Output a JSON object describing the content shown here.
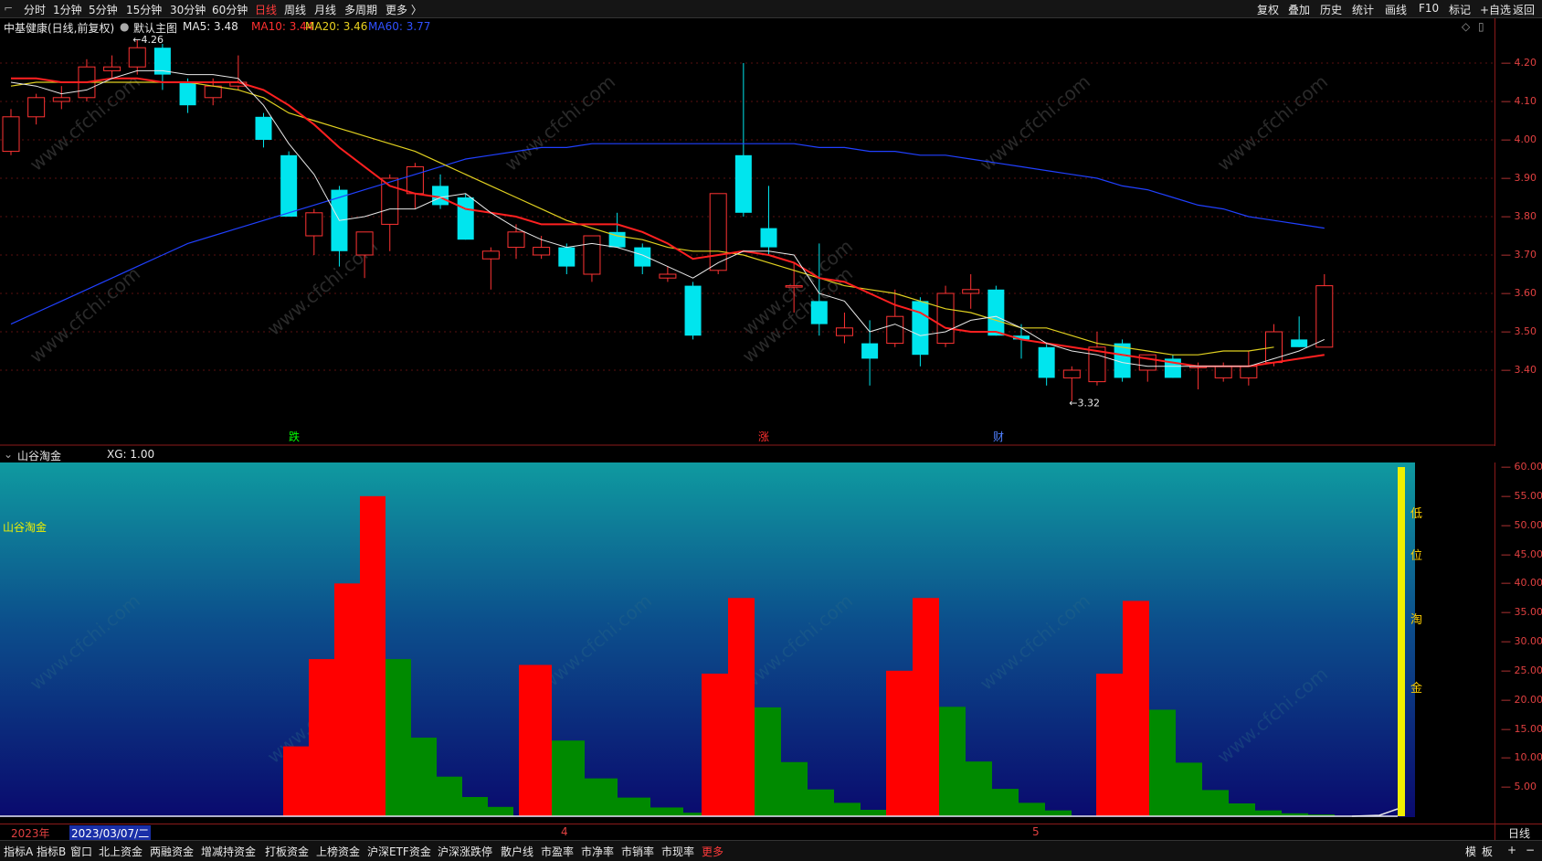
{
  "topbar": {
    "tabs": [
      "分时",
      "1分钟",
      "5分钟",
      "15分钟",
      "30分钟",
      "60分钟",
      "日线",
      "周线",
      "月线",
      "多周期",
      "更多 〉"
    ],
    "active_tab": "日线",
    "right_buttons": [
      "复权",
      "叠加",
      "历史",
      "统计",
      "画线",
      "F10",
      "标记",
      "+自选",
      "返回"
    ]
  },
  "info": {
    "stock": "中基健康(日线,前复权)",
    "theme": "默认主图",
    "ma5": "MA5: 3.48",
    "ma10": "MA10: 3.44",
    "ma20": "MA20: 3.46",
    "ma60": "MA60: 3.77",
    "high_label": "4.26",
    "low_label": "3.32",
    "events": [
      "跌",
      "涨",
      "财"
    ]
  },
  "colors": {
    "up": "#ff3333",
    "down": "#00e5ee",
    "ma5": "#e8e8e8",
    "ma10": "#ff2020",
    "ma20": "#e0d020",
    "ma60": "#2040ff",
    "bar_red": "#ff0000",
    "bar_green": "#008a00",
    "yellow_bar": "#f0f000"
  },
  "price_axis": [
    "4.20",
    "4.10",
    "4.00",
    "3.90",
    "3.80",
    "3.70",
    "3.60",
    "3.50",
    "3.40"
  ],
  "candles": [
    {
      "o": 3.97,
      "h": 4.08,
      "l": 3.96,
      "c": 4.06
    },
    {
      "o": 4.06,
      "h": 4.12,
      "l": 4.04,
      "c": 4.11
    },
    {
      "o": 4.1,
      "h": 4.14,
      "l": 4.08,
      "c": 4.11
    },
    {
      "o": 4.11,
      "h": 4.21,
      "l": 4.1,
      "c": 4.19
    },
    {
      "o": 4.18,
      "h": 4.22,
      "l": 4.16,
      "c": 4.19
    },
    {
      "o": 4.19,
      "h": 4.26,
      "l": 4.17,
      "c": 4.24
    },
    {
      "o": 4.24,
      "h": 4.25,
      "l": 4.13,
      "c": 4.17
    },
    {
      "o": 4.15,
      "h": 4.16,
      "l": 4.07,
      "c": 4.09
    },
    {
      "o": 4.11,
      "h": 4.16,
      "l": 4.09,
      "c": 4.14
    },
    {
      "o": 4.14,
      "h": 4.22,
      "l": 4.13,
      "c": 4.15
    },
    {
      "o": 4.06,
      "h": 4.07,
      "l": 3.98,
      "c": 4.0
    },
    {
      "o": 3.96,
      "h": 3.97,
      "l": 3.8,
      "c": 3.8
    },
    {
      "o": 3.75,
      "h": 3.82,
      "l": 3.7,
      "c": 3.81
    },
    {
      "o": 3.87,
      "h": 3.88,
      "l": 3.67,
      "c": 3.71
    },
    {
      "o": 3.7,
      "h": 3.76,
      "l": 3.64,
      "c": 3.76
    },
    {
      "o": 3.78,
      "h": 3.91,
      "l": 3.71,
      "c": 3.9
    },
    {
      "o": 3.86,
      "h": 3.94,
      "l": 3.82,
      "c": 3.93
    },
    {
      "o": 3.88,
      "h": 3.91,
      "l": 3.82,
      "c": 3.83
    },
    {
      "o": 3.85,
      "h": 3.86,
      "l": 3.74,
      "c": 3.74
    },
    {
      "o": 3.69,
      "h": 3.72,
      "l": 3.61,
      "c": 3.71
    },
    {
      "o": 3.72,
      "h": 3.78,
      "l": 3.69,
      "c": 3.76
    },
    {
      "o": 3.7,
      "h": 3.75,
      "l": 3.69,
      "c": 3.72
    },
    {
      "o": 3.72,
      "h": 3.73,
      "l": 3.65,
      "c": 3.67
    },
    {
      "o": 3.65,
      "h": 3.75,
      "l": 3.63,
      "c": 3.75
    },
    {
      "o": 3.76,
      "h": 3.81,
      "l": 3.72,
      "c": 3.72
    },
    {
      "o": 3.72,
      "h": 3.73,
      "l": 3.65,
      "c": 3.67
    },
    {
      "o": 3.64,
      "h": 3.67,
      "l": 3.63,
      "c": 3.65
    },
    {
      "o": 3.62,
      "h": 3.63,
      "l": 3.48,
      "c": 3.49
    },
    {
      "o": 3.66,
      "h": 3.86,
      "l": 3.65,
      "c": 3.86
    },
    {
      "o": 3.96,
      "h": 4.2,
      "l": 3.8,
      "c": 3.81
    },
    {
      "o": 3.77,
      "h": 3.88,
      "l": 3.7,
      "c": 3.72
    },
    {
      "o": 3.62,
      "h": 3.68,
      "l": 3.55,
      "c": 3.62
    },
    {
      "o": 3.58,
      "h": 3.73,
      "l": 3.49,
      "c": 3.52
    },
    {
      "o": 3.49,
      "h": 3.55,
      "l": 3.47,
      "c": 3.51
    },
    {
      "o": 3.47,
      "h": 3.53,
      "l": 3.36,
      "c": 3.43
    },
    {
      "o": 3.47,
      "h": 3.61,
      "l": 3.46,
      "c": 3.54
    },
    {
      "o": 3.58,
      "h": 3.59,
      "l": 3.41,
      "c": 3.44
    },
    {
      "o": 3.47,
      "h": 3.62,
      "l": 3.46,
      "c": 3.6
    },
    {
      "o": 3.6,
      "h": 3.65,
      "l": 3.56,
      "c": 3.61
    },
    {
      "o": 3.61,
      "h": 3.62,
      "l": 3.49,
      "c": 3.49
    },
    {
      "o": 3.49,
      "h": 3.52,
      "l": 3.43,
      "c": 3.48
    },
    {
      "o": 3.46,
      "h": 3.47,
      "l": 3.36,
      "c": 3.38
    },
    {
      "o": 3.38,
      "h": 3.41,
      "l": 3.32,
      "c": 3.4
    },
    {
      "o": 3.37,
      "h": 3.5,
      "l": 3.36,
      "c": 3.46
    },
    {
      "o": 3.47,
      "h": 3.48,
      "l": 3.37,
      "c": 3.38
    },
    {
      "o": 3.4,
      "h": 3.44,
      "l": 3.37,
      "c": 3.44
    },
    {
      "o": 3.43,
      "h": 3.44,
      "l": 3.38,
      "c": 3.38
    },
    {
      "o": 3.41,
      "h": 3.42,
      "l": 3.35,
      "c": 3.41
    },
    {
      "o": 3.38,
      "h": 3.42,
      "l": 3.37,
      "c": 3.41
    },
    {
      "o": 3.38,
      "h": 3.45,
      "l": 3.36,
      "c": 3.41
    },
    {
      "o": 3.42,
      "h": 3.52,
      "l": 3.41,
      "c": 3.5
    },
    {
      "o": 3.48,
      "h": 3.54,
      "l": 3.46,
      "c": 3.46
    },
    {
      "o": 3.46,
      "h": 3.65,
      "l": 3.46,
      "c": 3.62
    }
  ],
  "ma5_values": [
    4.15,
    4.14,
    4.12,
    4.13,
    4.16,
    4.18,
    4.18,
    4.17,
    4.17,
    4.16,
    4.09,
    3.99,
    3.91,
    3.79,
    3.8,
    3.82,
    3.82,
    3.85,
    3.86,
    3.81,
    3.77,
    3.74,
    3.72,
    3.73,
    3.72,
    3.7,
    3.67,
    3.64,
    3.68,
    3.71,
    3.71,
    3.7,
    3.6,
    3.58,
    3.5,
    3.52,
    3.49,
    3.5,
    3.53,
    3.54,
    3.51,
    3.47,
    3.45,
    3.44,
    3.42,
    3.41,
    3.41,
    3.41,
    3.41,
    3.41,
    3.43,
    3.45,
    3.48
  ],
  "ma10_values": [
    4.16,
    4.16,
    4.15,
    4.15,
    4.16,
    4.16,
    4.15,
    4.15,
    4.15,
    4.15,
    4.13,
    4.09,
    4.04,
    3.98,
    3.93,
    3.88,
    3.86,
    3.85,
    3.82,
    3.81,
    3.8,
    3.78,
    3.78,
    3.78,
    3.78,
    3.76,
    3.73,
    3.69,
    3.7,
    3.71,
    3.7,
    3.68,
    3.64,
    3.63,
    3.6,
    3.57,
    3.55,
    3.51,
    3.5,
    3.5,
    3.48,
    3.47,
    3.46,
    3.45,
    3.44,
    3.43,
    3.42,
    3.41,
    3.41,
    3.41,
    3.42,
    3.43,
    3.44
  ],
  "ma20_values": [
    4.14,
    4.15,
    4.15,
    4.15,
    4.15,
    4.15,
    4.15,
    4.15,
    4.14,
    4.13,
    4.11,
    4.07,
    4.05,
    4.03,
    4.01,
    3.99,
    3.97,
    3.94,
    3.91,
    3.88,
    3.85,
    3.82,
    3.79,
    3.77,
    3.75,
    3.74,
    3.72,
    3.71,
    3.71,
    3.7,
    3.68,
    3.66,
    3.64,
    3.62,
    3.61,
    3.6,
    3.58,
    3.56,
    3.55,
    3.53,
    3.51,
    3.51,
    3.49,
    3.47,
    3.46,
    3.45,
    3.44,
    3.44,
    3.45,
    3.45,
    3.46
  ],
  "ma60_values": [
    3.52,
    3.55,
    3.58,
    3.61,
    3.64,
    3.67,
    3.7,
    3.73,
    3.75,
    3.77,
    3.79,
    3.81,
    3.83,
    3.85,
    3.87,
    3.89,
    3.91,
    3.93,
    3.95,
    3.96,
    3.97,
    3.98,
    3.98,
    3.99,
    3.99,
    3.99,
    3.99,
    3.99,
    3.99,
    3.99,
    3.99,
    3.99,
    3.98,
    3.98,
    3.97,
    3.97,
    3.96,
    3.96,
    3.95,
    3.94,
    3.93,
    3.92,
    3.91,
    3.9,
    3.88,
    3.87,
    3.85,
    3.83,
    3.82,
    3.8,
    3.79,
    3.78,
    3.77
  ],
  "sub": {
    "title": "山谷淘金",
    "xg": "XG: 1.00",
    "label": "山谷淘金",
    "side_chars": [
      "低",
      "位",
      "淘",
      "金"
    ],
    "axis": [
      "60.00",
      "55.00",
      "50.00",
      "45.00",
      "40.00",
      "35.00",
      "30.00",
      "25.00",
      "20.00",
      "15.00",
      "10.00",
      "5.00"
    ],
    "bars": [
      {
        "color": "red",
        "v": 12
      },
      {
        "color": "red",
        "v": 27
      },
      {
        "color": "red",
        "v": 40
      },
      {
        "color": "red",
        "v": 55
      },
      {
        "color": "green",
        "v": 27
      },
      {
        "color": "green",
        "v": 13.5
      },
      {
        "color": "green",
        "v": 6.8
      },
      {
        "color": "green",
        "v": 3.3
      },
      {
        "color": "green",
        "v": 1.6
      },
      {
        "color": "red",
        "v": 26
      },
      {
        "color": "green",
        "v": 13
      },
      {
        "color": "green",
        "v": 6.5
      },
      {
        "color": "green",
        "v": 3.2
      },
      {
        "color": "green",
        "v": 1.5
      },
      {
        "color": "green",
        "v": 0.6
      },
      {
        "color": "red",
        "v": 24.5
      },
      {
        "color": "red",
        "v": 37.5
      },
      {
        "color": "green",
        "v": 18.7
      },
      {
        "color": "green",
        "v": 9.3
      },
      {
        "color": "green",
        "v": 4.6
      },
      {
        "color": "green",
        "v": 2.3
      },
      {
        "color": "green",
        "v": 1.1
      },
      {
        "color": "red",
        "v": 25
      },
      {
        "color": "red",
        "v": 37.5
      },
      {
        "color": "green",
        "v": 18.8
      },
      {
        "color": "green",
        "v": 9.4
      },
      {
        "color": "green",
        "v": 4.7
      },
      {
        "color": "green",
        "v": 2.3
      },
      {
        "color": "green",
        "v": 1.0
      },
      {
        "color": "red",
        "v": 24.5
      },
      {
        "color": "red",
        "v": 37
      },
      {
        "color": "green",
        "v": 18.3
      },
      {
        "color": "green",
        "v": 9.2
      },
      {
        "color": "green",
        "v": 4.5
      },
      {
        "color": "green",
        "v": 2.2
      },
      {
        "color": "green",
        "v": 1.0
      },
      {
        "color": "green",
        "v": 0.5
      },
      {
        "color": "green",
        "v": 0.3
      }
    ]
  },
  "date_axis": {
    "year": "2023年",
    "cursor_date": "2023/03/07/二",
    "months": [
      "4",
      "5"
    ],
    "period": "日线"
  },
  "bottombar": {
    "items": [
      "指标A",
      "指标B",
      "窗口",
      "北上资金",
      "两融资金",
      "增减持资金",
      "打板资金",
      "上榜资金",
      "沪深ETF资金",
      "沪深涨跌停",
      "散户线",
      "市盈率",
      "市净率",
      "市销率",
      "市现率",
      "更多"
    ],
    "right": [
      "模",
      "板",
      "+",
      "−"
    ]
  },
  "watermark": "www.cfchi.com"
}
